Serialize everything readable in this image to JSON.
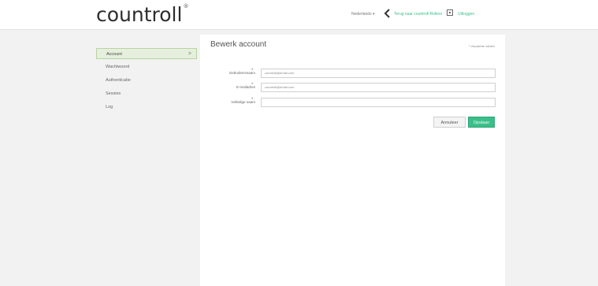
{
  "header": {
    "logo_text": "countroll",
    "logo_mark": "®",
    "language": "Nederlands ▾",
    "back_link": "Terug naar countroll Rollers",
    "logout_link": "Uitloggen"
  },
  "sidebar": {
    "items": [
      {
        "label": "Account",
        "active": true
      },
      {
        "label": "Wachtwoord",
        "active": false
      },
      {
        "label": "Authenticatie",
        "active": false
      },
      {
        "label": "Sessies",
        "active": false
      },
      {
        "label": "Log",
        "active": false
      }
    ]
  },
  "main": {
    "title": "Bewerk account",
    "required_note": "* Verplichte velden",
    "fields": [
      {
        "label": "Gebruikersnaam",
        "value": "countroll@email.com"
      },
      {
        "label": "E-mailadres",
        "value": "countroll@email.com"
      },
      {
        "label": "Volledige naam",
        "value": ""
      }
    ],
    "cancel_label": "Annuleer",
    "save_label": "Opslaan"
  },
  "colors": {
    "accent": "#3bbf8a",
    "active_bg": "#e6efdd",
    "page_bg": "#f2f2f2"
  }
}
